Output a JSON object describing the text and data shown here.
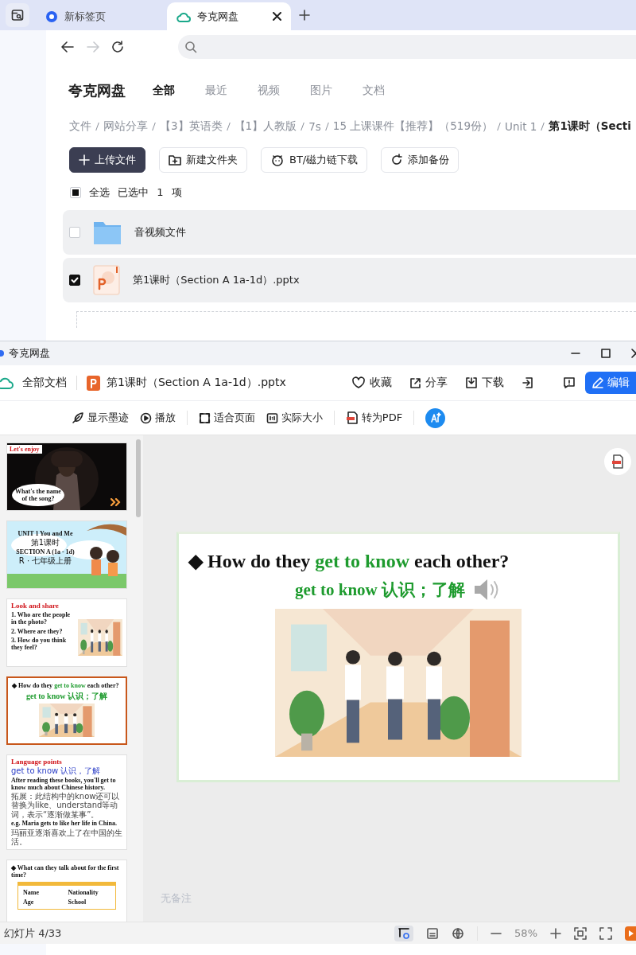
{
  "browser": {
    "tabs": [
      {
        "title": "新标签页",
        "selected": false,
        "kind": "newtab"
      },
      {
        "title": "夸克网盘",
        "selected": true,
        "kind": "cloud"
      }
    ]
  },
  "drive": {
    "logo": "夸克网盘",
    "nav": [
      {
        "label": "全部",
        "selected": true
      },
      {
        "label": "最近",
        "selected": false
      },
      {
        "label": "视频",
        "selected": false
      },
      {
        "label": "图片",
        "selected": false
      },
      {
        "label": "文档",
        "selected": false
      }
    ],
    "breadcrumbs": [
      "文件",
      "网站分享",
      "【3】英语类",
      "【1】人教版",
      "7s",
      "15 上课课件【推荐】（519份）",
      "Unit 1",
      "第1课时（Secti"
    ],
    "actions": [
      {
        "label": "上传文件",
        "kind": "primary"
      },
      {
        "label": "新建文件夹",
        "kind": "folder"
      },
      {
        "label": "BT/磁力链下载",
        "kind": "bt"
      },
      {
        "label": "添加备份",
        "kind": "backup"
      }
    ],
    "select_all": {
      "label": "全选",
      "indeterminate": true
    },
    "selection": "已选中 1 项",
    "files": [
      {
        "name": "音视频文件",
        "kind": "folder",
        "checked": false
      },
      {
        "name": "第1课时（Section A 1a-1d）.pptx",
        "kind": "pptx",
        "checked": true
      }
    ]
  },
  "viewer": {
    "window_title": "夸克网盘",
    "home": "全部文档",
    "file_name": "第1课时（Section A 1a-1d）.pptx",
    "actions": [
      "收藏",
      "分享",
      "下载"
    ],
    "edit": "编辑",
    "tools": [
      "显示墨迹",
      "播放",
      "适合页面",
      "实际大小",
      "转为PDF"
    ],
    "thumbnails": [
      {
        "selected": false,
        "heading": "Let's enjoy",
        "bubble": "What's the name of the song?"
      },
      {
        "kind": "cover",
        "selected": false,
        "heading": "UNIT 1 You and Me",
        "lines": [
          "第1课时",
          "SECTION A (1a - 1d)",
          "R · 七年级上册"
        ]
      },
      {
        "kind": "questions",
        "selected": false,
        "heading": "Look and share",
        "items": [
          "1.  Who are the people in the photo?",
          "2.  Where are they?",
          "3.  How do you think they feel?"
        ]
      },
      {
        "kind": "phrase",
        "selected": true,
        "bullet": "◆",
        "title": [
          {
            "text": "How do they ",
            "highlight": false
          },
          {
            "text": "get to know",
            "highlight": true
          },
          {
            "text": " each other?",
            "highlight": false
          }
        ],
        "phrase": "get to know 认识；了解"
      },
      {
        "kind": "notes",
        "selected": false,
        "heading": "Language points",
        "lines": [
          "get to know 认识，了解",
          "After reading these books, you'll get to know much about Chinese history.",
          "拓展：此结构中的know还可以替换为like、understand等动词，表示“逐渐做某事”。",
          "e.g. Maria gets to like her life in China.",
          "玛丽亚逐渐喜欢上了在中国的生活。"
        ]
      },
      {
        "kind": "table",
        "selected": false,
        "bullet": "◆",
        "title": "What can they talk about for the first time?",
        "cells": [
          "Name",
          "Nationality",
          "Age",
          "School"
        ]
      }
    ],
    "slide": {
      "bullet": "◆",
      "title": [
        {
          "text": "How do they ",
          "highlight": false
        },
        {
          "text": "get to know",
          "highlight": true
        },
        {
          "text": " each other?",
          "highlight": false
        }
      ],
      "phrase": "get to know 认识；了解"
    },
    "notes": "无备注",
    "status": "幻灯片 4/33",
    "zoom": "58%"
  }
}
